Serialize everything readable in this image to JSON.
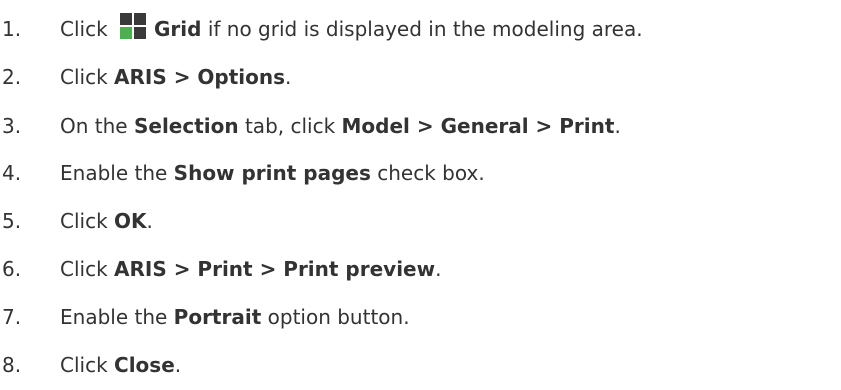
{
  "steps": [
    {
      "number": "1.",
      "parts": [
        {
          "t": "Click ",
          "b": false
        },
        {
          "icon": "grid-icon"
        },
        {
          "t": "Grid",
          "b": true
        },
        {
          "t": " if no grid is displayed in the modeling area.",
          "b": false
        }
      ]
    },
    {
      "number": "2.",
      "parts": [
        {
          "t": "Click ",
          "b": false
        },
        {
          "t": "ARIS > Options",
          "b": true
        },
        {
          "t": ".",
          "b": false
        }
      ]
    },
    {
      "number": "3.",
      "parts": [
        {
          "t": "On the ",
          "b": false
        },
        {
          "t": "Selection",
          "b": true
        },
        {
          "t": " tab, click ",
          "b": false
        },
        {
          "t": "Model > General > Print",
          "b": true
        },
        {
          "t": ".",
          "b": false
        }
      ]
    },
    {
      "number": "4.",
      "parts": [
        {
          "t": "Enable the ",
          "b": false
        },
        {
          "t": "Show print pages",
          "b": true
        },
        {
          "t": " check box.",
          "b": false
        }
      ]
    },
    {
      "number": "5.",
      "parts": [
        {
          "t": "Click ",
          "b": false
        },
        {
          "t": "OK",
          "b": true
        },
        {
          "t": ".",
          "b": false
        }
      ]
    },
    {
      "number": "6.",
      "parts": [
        {
          "t": "Click ",
          "b": false
        },
        {
          "t": "ARIS > Print > Print preview",
          "b": true
        },
        {
          "t": ".",
          "b": false
        }
      ]
    },
    {
      "number": "7.",
      "parts": [
        {
          "t": "Enable the ",
          "b": false
        },
        {
          "t": "Portrait",
          "b": true
        },
        {
          "t": " option button.",
          "b": false
        }
      ]
    },
    {
      "number": "8.",
      "parts": [
        {
          "t": "Click ",
          "b": false
        },
        {
          "t": "Close",
          "b": true
        },
        {
          "t": ".",
          "b": false
        }
      ]
    }
  ],
  "colors": {
    "text": "#333333",
    "grid_icon_dark": "#3a3a3a",
    "grid_icon_green": "#4caf50"
  }
}
